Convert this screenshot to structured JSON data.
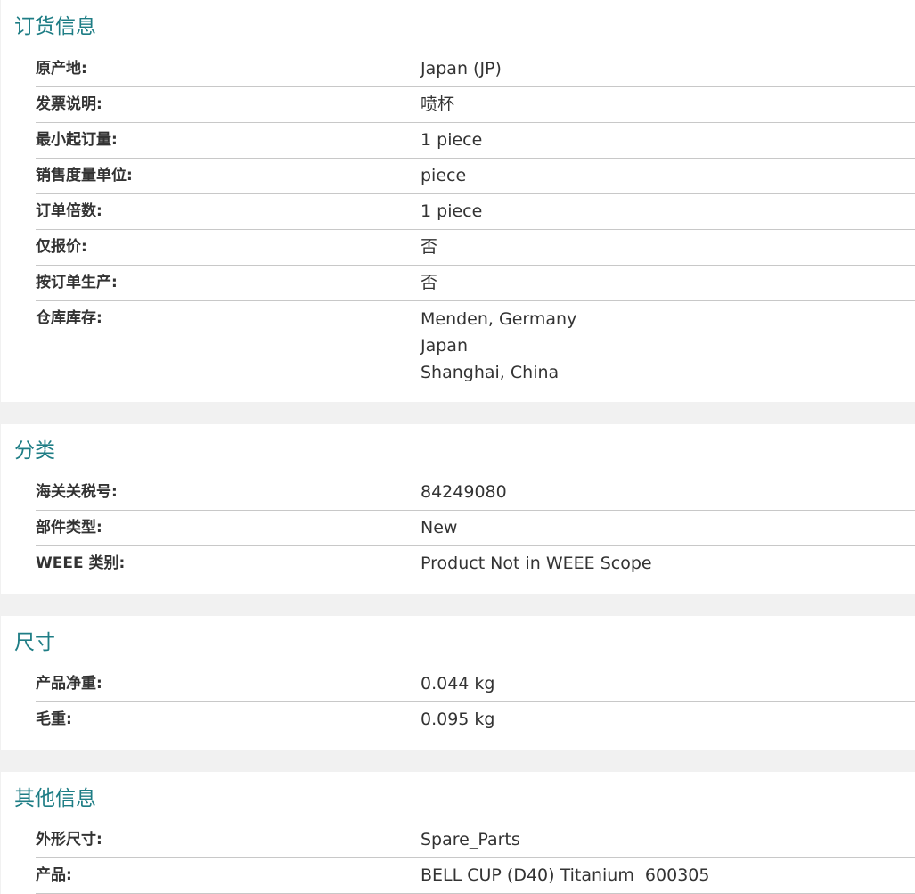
{
  "sections": {
    "ordering": {
      "title": "订货信息",
      "rows": [
        {
          "label": "原产地:",
          "value": "Japan (JP)"
        },
        {
          "label": "发票说明:",
          "value": "喷杯"
        },
        {
          "label": "最小起订量:",
          "value": "1 piece"
        },
        {
          "label": "销售度量单位:",
          "value": "piece"
        },
        {
          "label": "订单倍数:",
          "value": "1 piece"
        },
        {
          "label": "仅报价:",
          "value": "否"
        },
        {
          "label": "按订单生产:",
          "value": "否"
        },
        {
          "label": "仓库库存:",
          "values": [
            "Menden, Germany",
            "Japan",
            "Shanghai, China"
          ]
        }
      ]
    },
    "classification": {
      "title": "分类",
      "rows": [
        {
          "label": "海关关税号:",
          "value": "84249080"
        },
        {
          "label": "部件类型:",
          "value": "New"
        },
        {
          "label": "WEEE 类别:",
          "value": "Product Not in WEEE Scope"
        }
      ]
    },
    "dimensions": {
      "title": "尺寸",
      "rows": [
        {
          "label": "产品净重:",
          "value": "0.044 kg"
        },
        {
          "label": "毛重:",
          "value": "0.095 kg"
        }
      ]
    },
    "other": {
      "title": "其他信息",
      "rows": [
        {
          "label": "外形尺寸:",
          "value": "Spare_Parts"
        },
        {
          "label": "产品:",
          "value": "BELL CUP (D40) Titanium  600305"
        }
      ]
    }
  },
  "colors": {
    "title": "#1e7d85",
    "text": "#333333",
    "divider": "#c8c8c8",
    "background": "#f1f1f1"
  }
}
